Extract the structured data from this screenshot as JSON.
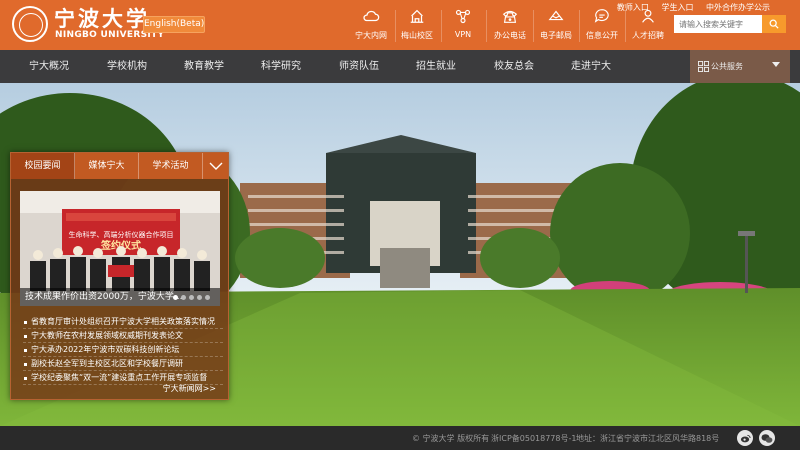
{
  "header": {
    "logo_cn": "宁波大学",
    "logo_en": "NINGBO UNIVERSITY",
    "english_button": "English(Beta)",
    "quick_links": [
      {
        "label": "宁大内网",
        "icon": "cloud-icon"
      },
      {
        "label": "梅山校区",
        "icon": "campus-building-icon"
      },
      {
        "label": "VPN",
        "icon": "vpn-network-icon"
      },
      {
        "label": "办公电话",
        "icon": "phone-icon"
      },
      {
        "label": "电子邮局",
        "icon": "mail-icon"
      },
      {
        "label": "信息公开",
        "icon": "chat-bubble-icon"
      },
      {
        "label": "人才招聘",
        "icon": "person-icon"
      }
    ],
    "top_links": [
      "教师入口",
      "学生入口",
      "中外合作办学公示"
    ],
    "search": {
      "placeholder": "请输入搜索关键字",
      "icon": "search-icon"
    },
    "colors": {
      "brand": "#e06a2c",
      "nav": "#3b3b3d",
      "search_button": "#f79a2c"
    }
  },
  "nav": {
    "items": [
      "宁大概况",
      "学校机构",
      "教育教学",
      "科学研究",
      "师资队伍",
      "招生就业",
      "校友总会",
      "走进宁大"
    ],
    "service": {
      "label": "公共服务",
      "icon": "grid-icon"
    }
  },
  "news_panel": {
    "tabs": [
      "校园要闻",
      "媒体宁大",
      "学术活动"
    ],
    "active_tab": 0,
    "slide": {
      "caption": "技术成果作价出资2000万，宁波大学...",
      "banner_text": "签约仪式",
      "banner_subtitle": "生命科学、高端分析仪器合作项目",
      "dots": 5,
      "active_dot": 0
    },
    "items": [
      "省教育厅审计处组织召开宁波大学相关政策落实情况",
      "宁大教师在农村发展领域权威期刊发表论文",
      "宁大承办2022年宁波市双碳科技创新论坛",
      "副校长赵全军到主校区北区和学校餐厅调研",
      "学校纪委聚焦“双一流”建设重点工作开展专项监督"
    ],
    "more": "宁大新闻网>>"
  },
  "footer": {
    "copyright": "© 宁波大学  版权所有",
    "icp": "浙ICP备05018778号-1",
    "address": "地址：浙江省宁波市江北区风华路818号",
    "icons": [
      "weibo-icon",
      "wechat-icon"
    ]
  }
}
